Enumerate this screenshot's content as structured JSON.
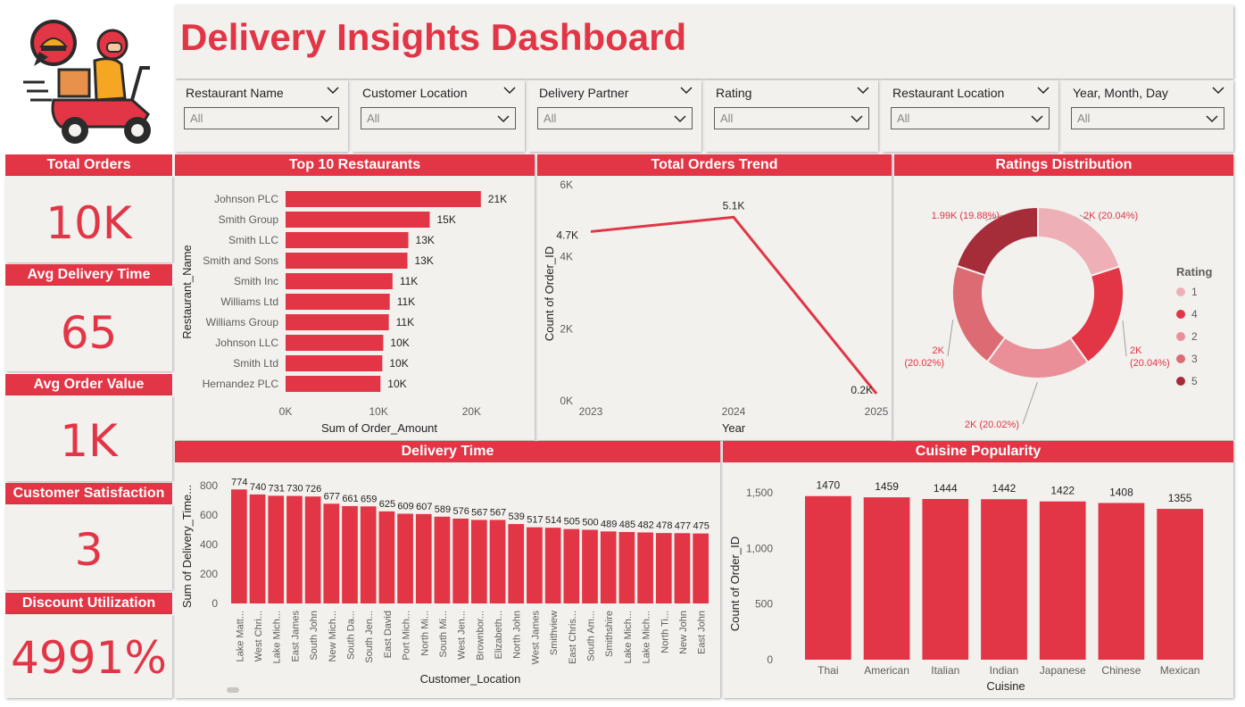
{
  "dashboard": {
    "title": "Delivery Insights Dashboard",
    "accent": "#e23545"
  },
  "logo": {
    "icon": "delivery-scooter-icon"
  },
  "slicers": [
    {
      "label": "Restaurant Name",
      "value": "All"
    },
    {
      "label": "Customer Location",
      "value": "All"
    },
    {
      "label": "Delivery Partner",
      "value": "All"
    },
    {
      "label": "Rating",
      "value": "All"
    },
    {
      "label": "Restaurant Location",
      "value": "All"
    },
    {
      "label": "Year, Month, Day",
      "value": "All"
    }
  ],
  "kpis": [
    {
      "label": "Total Orders",
      "value": "10K"
    },
    {
      "label": "Avg Delivery Time",
      "value": "65"
    },
    {
      "label": "Avg Order Value",
      "value": "1K"
    },
    {
      "label": "Customer Satisfaction",
      "value": "3"
    },
    {
      "label": "Discount Utilization",
      "value": "4991%"
    }
  ],
  "chart_data": [
    {
      "id": "top10",
      "type": "bar",
      "orientation": "horizontal",
      "title": "Top 10 Restaurants",
      "xlabel": "Sum of Order_Amount",
      "ylabel": "Restaurant_Name",
      "categories": [
        "Johnson PLC",
        "Smith Group",
        "Smith LLC",
        "Smith and Sons",
        "Smith Inc",
        "Williams Ltd",
        "Williams Group",
        "Johnson LLC",
        "Smith Ltd",
        "Hernandez PLC"
      ],
      "values": [
        21000,
        15500,
        13200,
        13100,
        11500,
        11200,
        11100,
        10500,
        10400,
        10200
      ],
      "data_labels": [
        "21K",
        "15K",
        "13K",
        "13K",
        "11K",
        "11K",
        "11K",
        "10K",
        "10K",
        "10K"
      ],
      "xticks": [
        "0K",
        "10K",
        "20K"
      ],
      "xlim": [
        0,
        21500
      ]
    },
    {
      "id": "trend",
      "type": "line",
      "title": "Total Orders Trend",
      "xlabel": "Year",
      "ylabel": "Count of Order_ID",
      "x": [
        "2023",
        "2024",
        "2025"
      ],
      "values": [
        4700,
        5100,
        200
      ],
      "data_labels": [
        "4.7K",
        "5.1K",
        "0.2K"
      ],
      "yticks": [
        "0K",
        "2K",
        "4K",
        "6K"
      ],
      "ylim": [
        0,
        6000
      ]
    },
    {
      "id": "ratings",
      "type": "pie",
      "donut": true,
      "title": "Ratings Distribution",
      "legend_title": "Rating",
      "legend_position": "right",
      "slices": [
        {
          "label": "1",
          "value": 20.04,
          "display": "2K (20.04%)",
          "color": "#eeb0b6"
        },
        {
          "label": "4",
          "value": 20.04,
          "display": "2K\n(20.04%)",
          "color": "#e23545"
        },
        {
          "label": "2",
          "value": 20.02,
          "display": "2K (20.02%)",
          "color": "#ea8f98"
        },
        {
          "label": "3",
          "value": 20.02,
          "display": "2K\n(20.02%)",
          "color": "#dd6b74"
        },
        {
          "label": "5",
          "value": 19.88,
          "display": "1.99K (19.88%)",
          "color": "#a52d39"
        }
      ]
    },
    {
      "id": "delivery",
      "type": "bar",
      "title": "Delivery Time",
      "xlabel": "Customer_Location",
      "ylabel": "Sum of Delivery_Time...",
      "categories": [
        "Lake Matt...",
        "West Chri...",
        "Lake Mich...",
        "East James",
        "South John",
        "New Mich...",
        "South Da...",
        "South Jen...",
        "East David",
        "Port Mich...",
        "North Mi...",
        "South Mi...",
        "West Jen...",
        "Brownbor...",
        "Elizabeth...",
        "North John",
        "West James",
        "Smithview",
        "East Chris...",
        "South Am...",
        "Smithshire",
        "Lake Mich...",
        "Lake Mich...",
        "North Ti...",
        "New John",
        "East John"
      ],
      "values": [
        774,
        740,
        731,
        730,
        726,
        677,
        661,
        659,
        625,
        609,
        607,
        589,
        576,
        567,
        567,
        539,
        517,
        514,
        505,
        500,
        489,
        485,
        482,
        478,
        477,
        475
      ],
      "yticks": [
        "0",
        "200",
        "400",
        "600",
        "800"
      ],
      "ylim": [
        0,
        800
      ]
    },
    {
      "id": "cuisine",
      "type": "bar",
      "title": "Cuisine Popularity",
      "xlabel": "Cuisine",
      "ylabel": "Count of Order_ID",
      "categories": [
        "Thai",
        "American",
        "Italian",
        "Indian",
        "Japanese",
        "Chinese",
        "Mexican"
      ],
      "values": [
        1470,
        1459,
        1444,
        1442,
        1422,
        1408,
        1355
      ],
      "yticks": [
        "0",
        "500",
        "1,000",
        "1,500"
      ],
      "ylim": [
        0,
        1500
      ]
    }
  ]
}
